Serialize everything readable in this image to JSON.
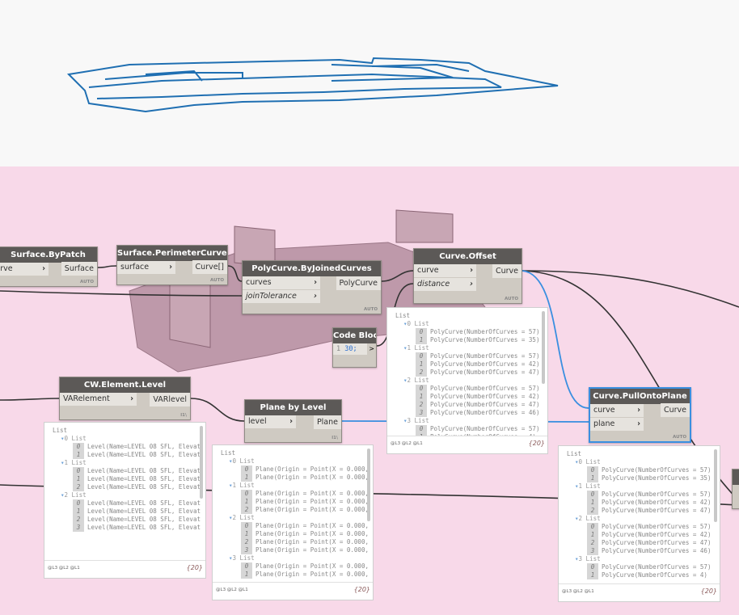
{
  "nodes": {
    "surface_by_patch": {
      "title": "Surface.ByPatch",
      "inputs": [
        "curve"
      ],
      "output": "Surface",
      "lacing": "AUTO"
    },
    "perimeter_curves": {
      "title": "Surface.PerimeterCurves",
      "inputs": [
        "surface"
      ],
      "output": "Curve[]",
      "lacing": "AUTO"
    },
    "joined_curves": {
      "title": "PolyCurve.ByJoinedCurves",
      "inputs": [
        "curves",
        "joinTolerance"
      ],
      "output": "PolyCurve",
      "lacing": "AUTO"
    },
    "code_block": {
      "title": "Code Block",
      "line": "1",
      "code": "30;",
      "output": ">"
    },
    "curve_offset": {
      "title": "Curve.Offset",
      "inputs": [
        "curve",
        "distance"
      ],
      "output": "Curve",
      "lacing": "AUTO"
    },
    "pull_onto_plane": {
      "title": "Curve.PullOntoPlane",
      "inputs": [
        "curve",
        "plane"
      ],
      "output": "Curve",
      "lacing": "AUTO"
    },
    "element_level": {
      "title": "CW.Element.Level",
      "inputs": [
        "VARelement"
      ],
      "output": "VARlevel",
      "lacing": "l1\\"
    },
    "plane_by_level": {
      "title": "Plane by Level",
      "inputs": [
        "level"
      ],
      "output": "Plane",
      "lacing": "l1\\"
    }
  },
  "watches": {
    "level": {
      "root": "List",
      "levels": "@L3 @L2 @L1",
      "count": "{20}",
      "groups": [
        {
          "label": "0 List",
          "items": [
            "Level(Name=LEVEL 08 SFL, Elevat",
            "Level(Name=LEVEL 08 SFL, Elevat"
          ]
        },
        {
          "label": "1 List",
          "items": [
            "Level(Name=LEVEL 08 SFL, Elevat",
            "Level(Name=LEVEL 08 SFL, Elevat",
            "Level(Name=LEVEL 08 SFL, Elevat"
          ]
        },
        {
          "label": "2 List",
          "items": [
            "Level(Name=LEVEL 08 SFL, Elevat",
            "Level(Name=LEVEL 08 SFL, Elevat",
            "Level(Name=LEVEL 08 SFL, Elevat",
            "Level(Name=LEVEL 08 SFL, Elevat"
          ]
        }
      ]
    },
    "plane": {
      "root": "List",
      "levels": "@L3 @L2 @L1",
      "count": "{20}",
      "groups": [
        {
          "label": "0 List",
          "items": [
            "Plane(Origin = Point(X = 0.000,",
            "Plane(Origin = Point(X = 0.000,"
          ]
        },
        {
          "label": "1 List",
          "items": [
            "Plane(Origin = Point(X = 0.000,",
            "Plane(Origin = Point(X = 0.000,",
            "Plane(Origin = Point(X = 0.000,"
          ]
        },
        {
          "label": "2 List",
          "items": [
            "Plane(Origin = Point(X = 0.000,",
            "Plane(Origin = Point(X = 0.000,",
            "Plane(Origin = Point(X = 0.000,",
            "Plane(Origin = Point(X = 0.000,"
          ]
        },
        {
          "label": "3 List",
          "items": [
            "Plane(Origin = Point(X = 0.000,",
            "Plane(Origin = Point(X = 0.000,"
          ]
        }
      ]
    },
    "offset": {
      "root": "List",
      "levels": "@L3 @L2 @L1",
      "count": "{20}",
      "groups": [
        {
          "label": "0 List",
          "items": [
            "PolyCurve(NumberOfCurves = 57)",
            "PolyCurve(NumberOfCurves = 35)"
          ]
        },
        {
          "label": "1 List",
          "items": [
            "PolyCurve(NumberOfCurves = 57)",
            "PolyCurve(NumberOfCurves = 42)",
            "PolyCurve(NumberOfCurves = 47)"
          ]
        },
        {
          "label": "2 List",
          "items": [
            "PolyCurve(NumberOfCurves = 57)",
            "PolyCurve(NumberOfCurves = 42)",
            "PolyCurve(NumberOfCurves = 47)",
            "PolyCurve(NumberOfCurves = 46)"
          ]
        },
        {
          "label": "3 List",
          "items": [
            "PolyCurve(NumberOfCurves = 57)",
            "PolyCurve(NumberOfCurves = 4)"
          ]
        }
      ]
    },
    "pull": {
      "root": "List",
      "levels": "@L3 @L2 @L1",
      "count": "{20}",
      "groups": [
        {
          "label": "0 List",
          "items": [
            "PolyCurve(NumberOfCurves = 57)",
            "PolyCurve(NumberOfCurves = 35)"
          ]
        },
        {
          "label": "1 List",
          "items": [
            "PolyCurve(NumberOfCurves = 57)",
            "PolyCurve(NumberOfCurves = 42)",
            "PolyCurve(NumberOfCurves = 47)"
          ]
        },
        {
          "label": "2 List",
          "items": [
            "PolyCurve(NumberOfCurves = 57)",
            "PolyCurve(NumberOfCurves = 42)",
            "PolyCurve(NumberOfCurves = 47)",
            "PolyCurve(NumberOfCurves = 46)"
          ]
        },
        {
          "label": "3 List",
          "items": [
            "PolyCurve(NumberOfCurves = 57)",
            "PolyCurve(NumberOfCurves = 4)"
          ]
        }
      ]
    }
  },
  "colors": {
    "canvas": "#f8d9e9",
    "preview_bg": "#f8f8f8",
    "geometry": "#1f6fb2",
    "selected_wire": "#3a8fe0",
    "node_header": "#5c5957"
  }
}
